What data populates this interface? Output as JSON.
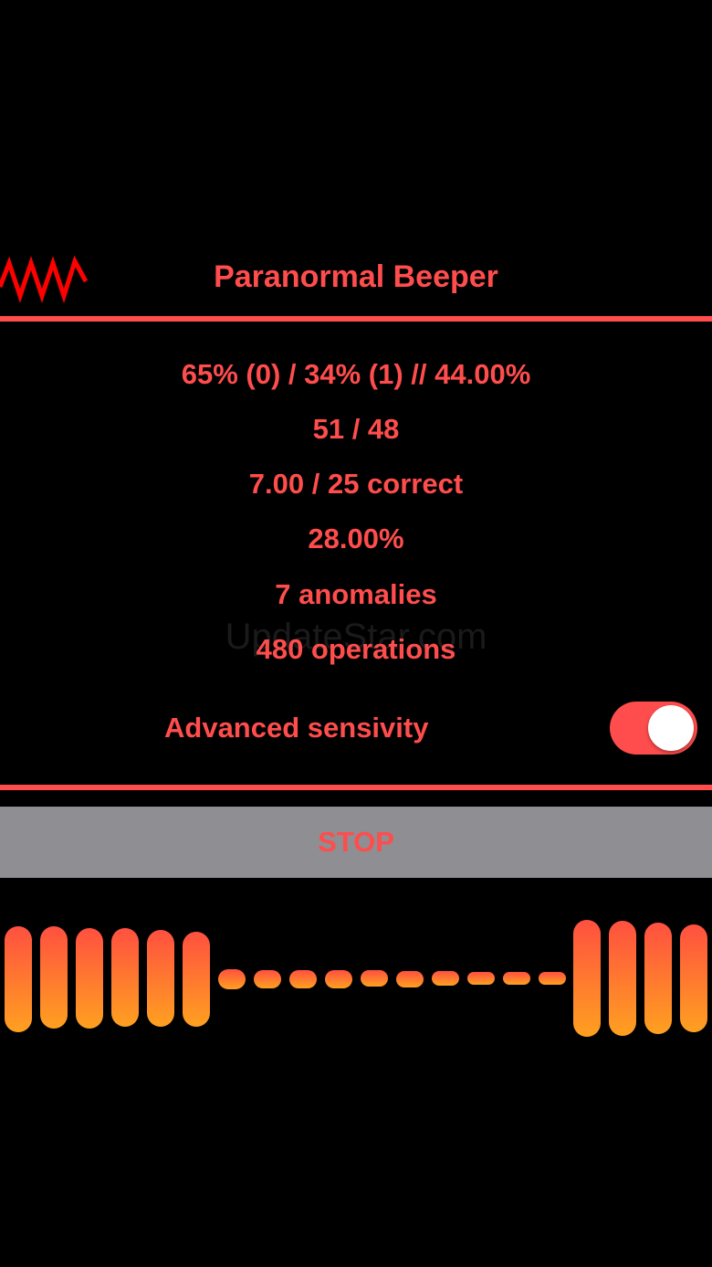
{
  "header": {
    "title": "Paranormal Beeper",
    "logo_icon": "waveform-icon"
  },
  "stats": [
    "65% (0) / 34% (1) // 44.00%",
    "51 / 48",
    "7.00 / 25 correct",
    "28.00%",
    "7 anomalies",
    "480 operations"
  ],
  "watermark": "UpdateStar.com",
  "settings": {
    "advanced_label": "Advanced sensivity",
    "advanced_on": true
  },
  "controls": {
    "stop_label": "STOP"
  },
  "meter": {
    "bar_count": 20
  },
  "colors": {
    "accent": "#ff4d4d",
    "button_bg": "#8e8e93",
    "bar_gradient_top": "#ff5040",
    "bar_gradient_bottom": "#ffa020"
  }
}
